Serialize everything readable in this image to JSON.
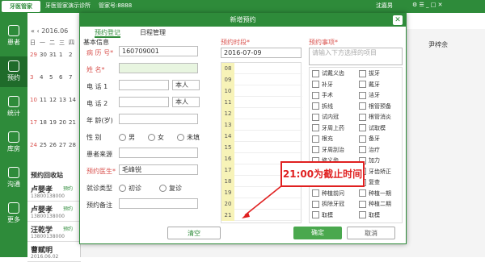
{
  "app": {
    "logo": "牙医管家",
    "clinic": "牙医管家演示诊所",
    "manager": "管家号:8888",
    "user": "沈嘉男"
  },
  "sidebar": [
    "患者",
    "预约",
    "统计",
    "库房",
    "沟通",
    "更多"
  ],
  "calendar": {
    "year_month": "2016.06",
    "weekdays": [
      "日",
      "一",
      "二",
      "三",
      "四"
    ],
    "days": [
      [
        "29",
        "30",
        "31",
        "1",
        "2"
      ],
      [
        "3",
        "4",
        "5",
        "6",
        "7"
      ],
      [
        "10",
        "11",
        "12",
        "13",
        "14"
      ],
      [
        "17",
        "18",
        "19",
        "20",
        "21"
      ],
      [
        "24",
        "25",
        "26",
        "27",
        "28"
      ]
    ]
  },
  "reminder_title": "预约回收站",
  "patients": [
    {
      "name": "卢婴孝",
      "tag": "预约",
      "phone": "13800138000"
    },
    {
      "name": "卢婴孝",
      "tag": "预约",
      "phone": "13800138000"
    },
    {
      "name": "汪乾学",
      "tag": "预约",
      "phone": "13800138000"
    },
    {
      "name": "曹赋明",
      "tag": "",
      "phone": "2016.06.02"
    }
  ],
  "bg_header": {
    "col1": "尹梓余"
  },
  "dialog": {
    "title": "新增预约",
    "tabs": [
      "预约登记",
      "日程管理"
    ],
    "section": "基本信息",
    "fields": {
      "record_no_label": "病 历 号*",
      "record_no": "160709001",
      "name_label": "姓 名*",
      "phone1_label": "电 话 1",
      "phone1_rel": "本人",
      "phone2_label": "电 话 2",
      "phone2_rel": "本人",
      "age_label": "年 龄(岁)",
      "gender_label": "性 别",
      "gender_options": [
        "男",
        "女",
        "未填"
      ],
      "source_label": "患者来源",
      "doctor_label": "预约医生*",
      "doctor": "毛峰锐",
      "visit_label": "就诊类型",
      "visit_options": [
        "初诊",
        "复诊"
      ],
      "remark_label": "预约备注"
    },
    "time_label": "预约时段*",
    "date": "2016-07-09",
    "times": [
      "08",
      "09",
      "10",
      "11",
      "12",
      "13",
      "14",
      "15",
      "16",
      "17",
      "18",
      "19",
      "20",
      "21"
    ],
    "items_label": "预约事项*",
    "items_search_placeholder": "请输入下方选择的项目",
    "items_col1": [
      "试戴义齿",
      "补牙",
      "手术",
      "拆线",
      "试内冠",
      "牙周上药",
      "根充",
      "牙周刮治",
      "修义齿",
      "上颌塑",
      "初诊",
      "种植前问",
      "拆除牙冠",
      "取模"
    ],
    "items_col2": [
      "拔牙",
      "戴牙",
      "洁牙",
      "根管预备",
      "根管消炎",
      "试取模",
      "备牙",
      "治疗",
      "加力",
      "牙齿矫正",
      "复查",
      "种植一期",
      "种植二期",
      "取模"
    ],
    "annotation": "21:00为截止时间",
    "buttons": {
      "clear": "清空",
      "confirm": "确定",
      "cancel": "取消"
    }
  }
}
